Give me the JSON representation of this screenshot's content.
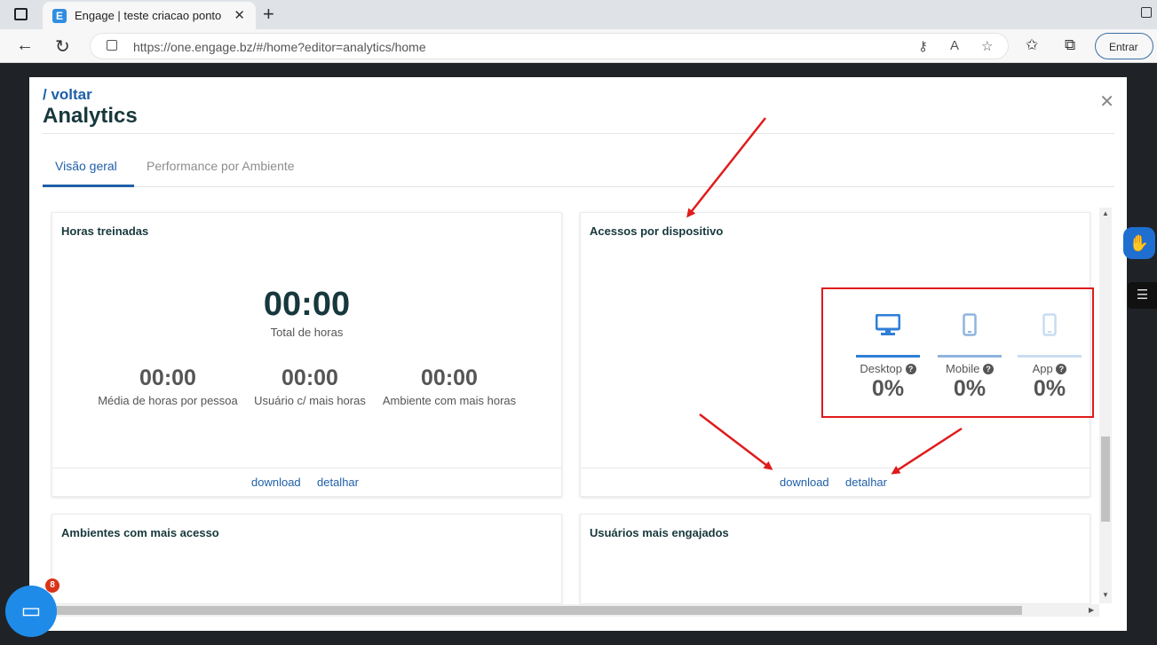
{
  "browser": {
    "tab_title": "Engage | teste criacao ponto",
    "tab_favicon": "E",
    "url": "https://one.engage.bz/#/home?editor=analytics/home",
    "signin_label": "Entrar"
  },
  "modal": {
    "back_label": "/ voltar",
    "title": "Analytics",
    "tabs": [
      {
        "label": "Visão geral",
        "active": true
      },
      {
        "label": "Performance por Ambiente",
        "active": false
      }
    ]
  },
  "cards": {
    "hours": {
      "title": "Horas treinadas",
      "total_value": "00:00",
      "total_label": "Total de horas",
      "stats": [
        {
          "value": "00:00",
          "label": "Média de horas por pessoa"
        },
        {
          "value": "00:00",
          "label": "Usuário c/ mais horas"
        },
        {
          "value": "00:00",
          "label": "Ambiente com mais horas"
        }
      ],
      "download_label": "download",
      "detail_label": "detalhar"
    },
    "devices": {
      "title": "Acessos por dispositivo",
      "items": [
        {
          "label": "Desktop",
          "value": "0%",
          "icon": "desktop-icon",
          "color": "#2f7fd6"
        },
        {
          "label": "Mobile",
          "value": "0%",
          "icon": "mobile-icon",
          "color": "#8fb4df"
        },
        {
          "label": "App",
          "value": "0%",
          "icon": "app-icon",
          "color": "#c9dcf1"
        }
      ],
      "download_label": "download",
      "detail_label": "detalhar"
    },
    "environments": {
      "title": "Ambientes com mais acesso"
    },
    "users": {
      "title": "Usuários mais engajados"
    }
  },
  "chat": {
    "badge_count": "8"
  },
  "colors": {
    "accent": "#1f5fa8",
    "annotation": "#e01b1b"
  }
}
